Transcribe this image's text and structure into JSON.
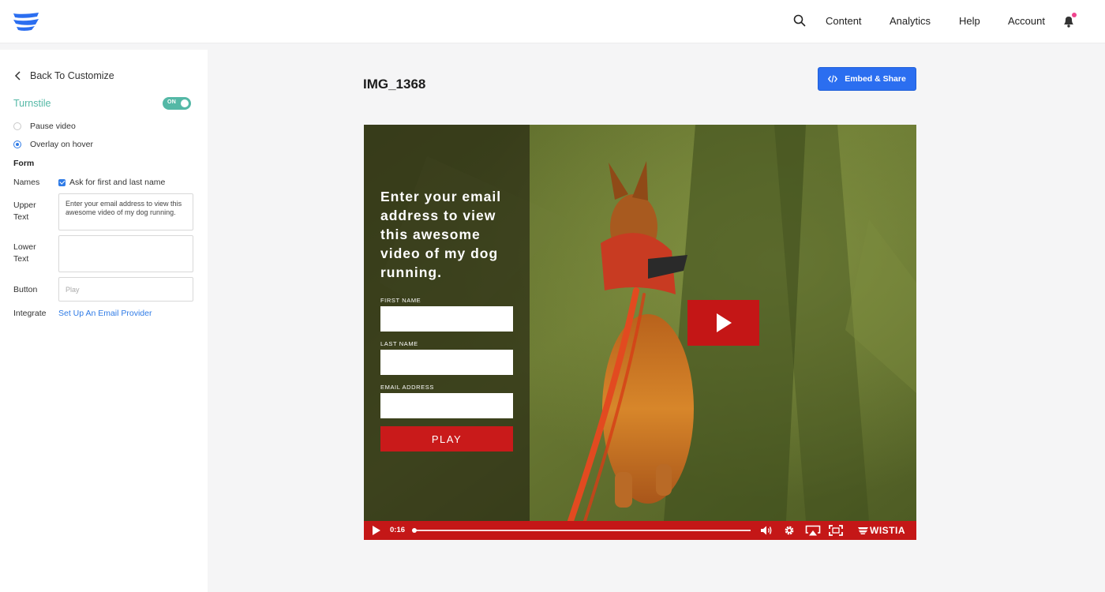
{
  "nav": {
    "links": [
      "Content",
      "Analytics",
      "Help",
      "Account"
    ],
    "notification_dot_color": "#f0458e",
    "brand_color": "#2b6ef0"
  },
  "sidebar": {
    "back_label": "Back To Customize",
    "turnstile_label": "Turnstile",
    "toggle_text": "ON",
    "radio_options": [
      {
        "label": "Pause video",
        "checked": false
      },
      {
        "label": "Overlay on hover",
        "checked": true
      }
    ],
    "form_heading": "Form",
    "names_label": "Names",
    "names_checkbox_label": "Ask for first and last name",
    "upper_text_label": "Upper Text",
    "upper_text_value": "Enter your email address to view this awesome video of my dog running.",
    "lower_text_label": "Lower Text",
    "lower_text_value": "",
    "button_label": "Button",
    "button_placeholder": "Play",
    "integrate_label": "Integrate",
    "integrate_link": "Set Up An Email Provider",
    "accent_color": "#54b8a6"
  },
  "main": {
    "video_title": "IMG_1368",
    "embed_button": "Embed & Share"
  },
  "player": {
    "overlay_title": "Enter your email address to view this awesome video of my dog running.",
    "fields": [
      "FIRST NAME",
      "LAST NAME",
      "EMAIL ADDRESS"
    ],
    "play_button": "PLAY",
    "time": "0:16",
    "brand": "WISTIA",
    "player_color": "#c41717"
  }
}
